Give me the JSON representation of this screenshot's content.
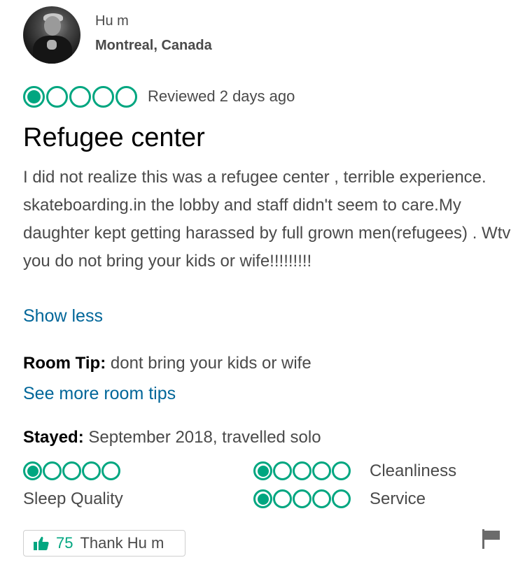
{
  "reviewer": {
    "name": "Hu m",
    "location": "Montreal, Canada"
  },
  "review": {
    "rating": 1,
    "rating_max": 5,
    "date": "Reviewed 2 days ago",
    "title": "Refugee center",
    "text": "I did not realize this was a refugee center , terrible experience. skateboarding.in the lobby and staff didn't seem to care.My daughter kept getting harassed by full grown men(refugees) . Wtv you do not bring your kids or wife!!!!!!!!!",
    "show_less": "Show less"
  },
  "room_tip": {
    "label": "Room Tip:",
    "text": "dont bring your kids or wife",
    "see_more": "See more room tips"
  },
  "stayed": {
    "label": "Stayed:",
    "text": "September 2018, travelled solo"
  },
  "subratings": [
    {
      "label": "Sleep Quality",
      "rating": 1
    },
    {
      "label": "Cleanliness",
      "rating": 1
    },
    {
      "label": "Service",
      "rating": 1
    }
  ],
  "actions": {
    "thank_count": "75",
    "thank_label": "Thank Hu m",
    "icons": {
      "thumb": "thumbs-up-icon",
      "flag": "flag-icon"
    }
  },
  "colors": {
    "brand_green": "#00a680",
    "link_blue": "#006699",
    "text_gray": "#4a4a4a"
  }
}
